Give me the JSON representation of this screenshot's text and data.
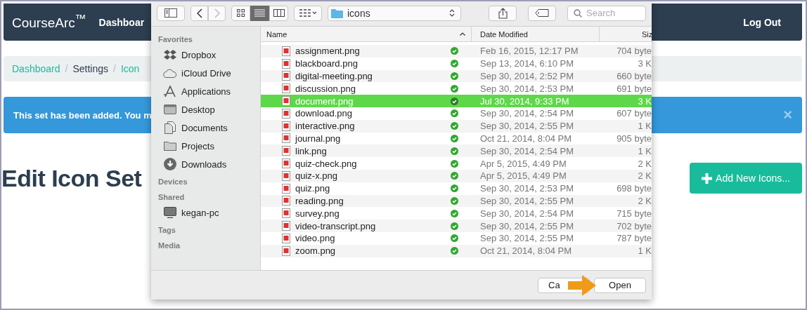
{
  "navbar": {
    "brand": "CourseArc$^{™}$",
    "links": [
      "Dashboar"
    ],
    "logout": "Log Out"
  },
  "breadcrumb_separator": "/",
  "breadcrumb": [
    {
      "label": "Dashboard",
      "kind": "link"
    },
    {
      "label": "Settings",
      "kind": "current"
    },
    {
      "label": "Icon",
      "kind": "link"
    }
  ],
  "alert": {
    "text": "This set has been added. You m",
    "close": "×"
  },
  "heading": "Edit Icon Set",
  "add_button": "Add New Icons...",
  "dialog": {
    "path": "icons",
    "search": {
      "placeholder": "Search"
    },
    "sidebar": [
      {
        "heading": "Favorites",
        "items": [
          {
            "label": "Dropbox",
            "kind": "dropbox"
          },
          {
            "label": "iCloud Drive",
            "kind": "cloud"
          },
          {
            "label": "Applications",
            "kind": "apps"
          },
          {
            "label": "Desktop",
            "kind": "desktop"
          },
          {
            "label": "Documents",
            "kind": "documents"
          },
          {
            "label": "Projects",
            "kind": "folder"
          },
          {
            "label": "Downloads",
            "kind": "downloads"
          }
        ]
      },
      {
        "heading": "Devices"
      },
      {
        "heading": "Shared",
        "items": [
          {
            "label": "kegan-pc",
            "kind": "computer"
          }
        ]
      },
      {
        "heading": "Tags"
      },
      {
        "heading": "Media"
      }
    ],
    "columns": [
      "Name",
      "Date Modified",
      "Siz"
    ],
    "rows": [
      {
        "name": "assignment.png",
        "date": "Feb 16, 2015, 12:17 PM",
        "size": "704 byte",
        "selected": false
      },
      {
        "name": "blackboard.png",
        "date": "Sep 13, 2014, 6:10 PM",
        "size": "3 K",
        "selected": false
      },
      {
        "name": "digital-meeting.png",
        "date": "Sep 30, 2014, 2:52 PM",
        "size": "660 byte",
        "selected": false
      },
      {
        "name": "discussion.png",
        "date": "Sep 30, 2014, 2:53 PM",
        "size": "691 byte",
        "selected": false
      },
      {
        "name": "document.png",
        "date": "Jul 30, 2014, 9:33 PM",
        "size": "3 K",
        "selected": true
      },
      {
        "name": "download.png",
        "date": "Sep 30, 2014, 2:54 PM",
        "size": "607 byte",
        "selected": false
      },
      {
        "name": "interactive.png",
        "date": "Sep 30, 2014, 2:55 PM",
        "size": "1 K",
        "selected": false
      },
      {
        "name": "journal.png",
        "date": "Oct 21, 2014, 8:04 PM",
        "size": "905 byte",
        "selected": false
      },
      {
        "name": "link.png",
        "date": "Sep 30, 2014, 2:54 PM",
        "size": "1 K",
        "selected": false
      },
      {
        "name": "quiz-check.png",
        "date": "Apr 5, 2015, 4:49 PM",
        "size": "2 K",
        "selected": false
      },
      {
        "name": "quiz-x.png",
        "date": "Apr 5, 2015, 4:49 PM",
        "size": "2 K",
        "selected": false
      },
      {
        "name": "quiz.png",
        "date": "Sep 30, 2014, 2:53 PM",
        "size": "698 byte",
        "selected": false
      },
      {
        "name": "reading.png",
        "date": "Sep 30, 2014, 2:55 PM",
        "size": "2 K",
        "selected": false
      },
      {
        "name": "survey.png",
        "date": "Sep 30, 2014, 2:54 PM",
        "size": "715 byte",
        "selected": false
      },
      {
        "name": "video-transcript.png",
        "date": "Sep 30, 2014, 2:55 PM",
        "size": "702 byte",
        "selected": false
      },
      {
        "name": "video.png",
        "date": "Sep 30, 2014, 2:55 PM",
        "size": "787 byte",
        "selected": false
      },
      {
        "name": "zoom.png",
        "date": "Oct 21, 2014, 8:04 PM",
        "size": "1 K",
        "selected": false
      }
    ],
    "buttons": [
      "Ca",
      "Open"
    ]
  }
}
